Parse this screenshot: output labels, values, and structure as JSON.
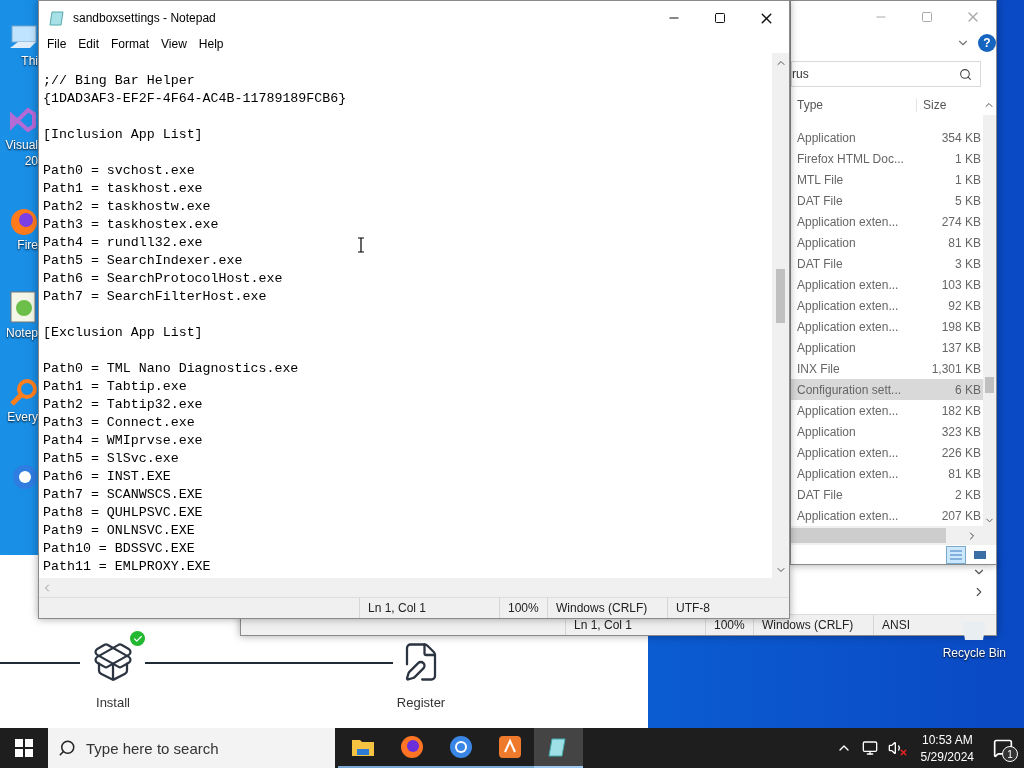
{
  "desktop_icons": [
    {
      "kind": "pc",
      "labels": [
        "Thi"
      ]
    },
    {
      "kind": "ide",
      "labels": [
        "Visual",
        "20"
      ]
    },
    {
      "kind": "browser",
      "labels": [
        "Fire"
      ]
    },
    {
      "kind": "notepad",
      "labels": [
        "Notep"
      ]
    },
    {
      "kind": "search",
      "labels": [
        "Every"
      ]
    },
    {
      "kind": "globe"
    }
  ],
  "installer": {
    "steps": [
      {
        "label": "Install",
        "kind": "package",
        "done": true
      },
      {
        "label": "Register",
        "kind": "document",
        "done": false
      }
    ]
  },
  "back_notepad": {
    "status_bar": [
      "Ln 1, Col 1",
      "100%",
      "Windows (CRLF)",
      "ANSI"
    ]
  },
  "explorer": {
    "help": "?",
    "search": {
      "value": "rus"
    },
    "columns": [
      "Type",
      "Size"
    ],
    "rows": [
      {
        "type": "Application",
        "size": "354 KB",
        "selected": false
      },
      {
        "type": "Firefox HTML Doc...",
        "size": "1 KB",
        "selected": false
      },
      {
        "type": "MTL File",
        "size": "1 KB",
        "selected": false
      },
      {
        "type": "DAT File",
        "size": "5 KB",
        "selected": false
      },
      {
        "type": "Application exten...",
        "size": "274 KB",
        "selected": false
      },
      {
        "type": "Application",
        "size": "81 KB",
        "selected": false
      },
      {
        "type": "DAT File",
        "size": "3 KB",
        "selected": false
      },
      {
        "type": "Application exten...",
        "size": "103 KB",
        "selected": false
      },
      {
        "type": "Application exten...",
        "size": "92 KB",
        "selected": false
      },
      {
        "type": "Application exten...",
        "size": "198 KB",
        "selected": false
      },
      {
        "type": "Application",
        "size": "137 KB",
        "selected": false
      },
      {
        "type": "INX File",
        "size": "1,301 KB",
        "selected": false
      },
      {
        "type": "Configuration sett...",
        "size": "6 KB",
        "selected": true
      },
      {
        "type": "Application exten...",
        "size": "182 KB",
        "selected": false
      },
      {
        "type": "Application",
        "size": "323 KB",
        "selected": false
      },
      {
        "type": "Application exten...",
        "size": "226 KB",
        "selected": false
      },
      {
        "type": "Application exten...",
        "size": "81 KB",
        "selected": false
      },
      {
        "type": "DAT File",
        "size": "2 KB",
        "selected": false
      },
      {
        "type": "Application exten...",
        "size": "207 KB",
        "selected": false
      }
    ]
  },
  "notepad": {
    "title": "sandboxsettings - Notepad",
    "menu": [
      "File",
      "Edit",
      "Format",
      "View",
      "Help"
    ],
    "text_blocks": [
      [
        ";// Bing Bar Helper",
        "{1DAD3AF3-EF2F-4F64-AC4B-11789189FCB6}"
      ],
      [
        "[Inclusion App List]"
      ],
      [
        "Path0 = svchost.exe",
        "Path1 = taskhost.exe",
        "Path2 = taskhostw.exe",
        "Path3 = taskhostex.exe",
        "Path4 = rundll32.exe",
        "Path5 = SearchIndexer.exe",
        "Path6 = SearchProtocolHost.exe",
        "Path7 = SearchFilterHost.exe"
      ],
      [
        "[Exclusion App List]"
      ],
      [
        "Path0 = TML Nano Diagnostics.exe",
        "Path1 = Tabtip.exe",
        "Path2 = Tabtip32.exe",
        "Path3 = Connect.exe",
        "Path4 = WMIprvse.exe",
        "Path5 = SlSvc.exe",
        "Path6 = INST.EXE",
        "Path7 = SCANWSCS.EXE",
        "Path8 = QUHLPSVC.EXE",
        "Path9 = ONLNSVC.EXE",
        "Path10 = BDSSVC.EXE",
        "Path11 = EMLPROXY.EXE"
      ]
    ],
    "status_bar": [
      "Ln 1, Col 1",
      "100%",
      "Windows (CRLF)",
      "UTF-8"
    ]
  },
  "recycle_bin": {
    "label": "Recycle Bin"
  },
  "taskbar": {
    "search": {
      "placeholder": "Type here to search"
    },
    "apps": [
      {
        "kind": "folder",
        "active": false
      },
      {
        "kind": "firefox",
        "active": false
      },
      {
        "kind": "chrome",
        "active": false
      },
      {
        "kind": "orange",
        "active": false
      },
      {
        "kind": "notepad",
        "active": true
      }
    ],
    "tray": {
      "volume_muted": true,
      "time": "10:53 AM",
      "date": "5/29/2024",
      "notifications": "1"
    }
  }
}
